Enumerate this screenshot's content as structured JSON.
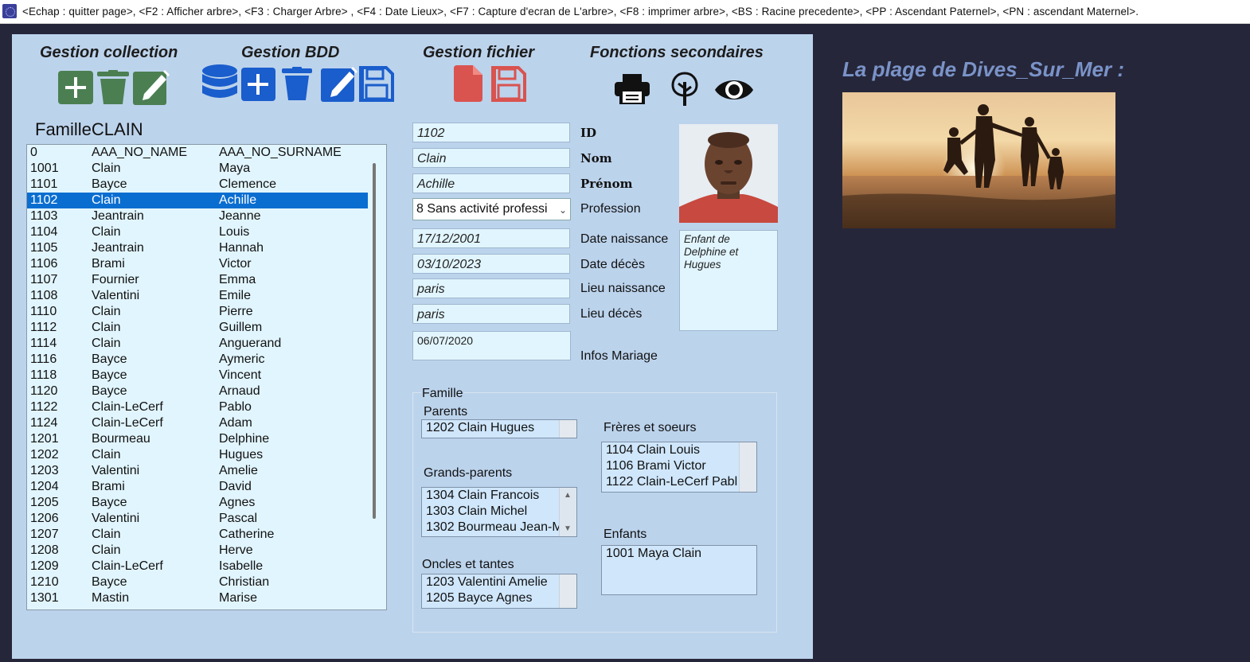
{
  "window": {
    "title": "<Echap : quitter page>, <F2 : Afficher arbre>, <F3 : Charger Arbre> , <F4 : Date Lieux>, <F7 : Capture d'ecran de L'arbre>, <F8 : imprimer arbre>, <BS : Racine precedente>, <PP : Ascendant Paternel>, <PN : ascendant Maternel>."
  },
  "toolbar": {
    "collection": {
      "title": "Gestion collection"
    },
    "bdd": {
      "title": "Gestion BDD"
    },
    "file": {
      "title": "Gestion fichier"
    },
    "secondary": {
      "title": "Fonctions secondaires"
    }
  },
  "colors": {
    "panel": "#bcd3ec",
    "green": "#4b7f52",
    "blue": "#1a5dcc",
    "red": "#d9534f",
    "selection": "#0a6ed1"
  },
  "family": {
    "name": "FamilleCLAIN"
  },
  "persons": [
    [
      "0",
      "AAA_NO_NAME",
      "AAA_NO_SURNAME"
    ],
    [
      "1001",
      "Clain",
      "Maya"
    ],
    [
      "1101",
      "Bayce",
      "Clemence"
    ],
    [
      "1102",
      "Clain",
      "Achille"
    ],
    [
      "1103",
      "Jeantrain",
      "Jeanne"
    ],
    [
      "1104",
      "Clain",
      "Louis"
    ],
    [
      "1105",
      "Jeantrain",
      "Hannah"
    ],
    [
      "1106",
      "Brami",
      "Victor"
    ],
    [
      "1107",
      "Fournier",
      "Emma"
    ],
    [
      "1108",
      "Valentini",
      "Emile"
    ],
    [
      "1110",
      "Clain",
      "Pierre"
    ],
    [
      "1112",
      "Clain",
      "Guillem"
    ],
    [
      "1114",
      "Clain",
      "Anguerand"
    ],
    [
      "1116",
      "Bayce",
      "Aymeric"
    ],
    [
      "1118",
      "Bayce",
      "Vincent"
    ],
    [
      "1120",
      "Bayce",
      "Arnaud"
    ],
    [
      "1122",
      "Clain-LeCerf",
      "Pablo"
    ],
    [
      "1124",
      "Clain-LeCerf",
      "Adam"
    ],
    [
      "1201",
      "Bourmeau",
      "Delphine"
    ],
    [
      "1202",
      "Clain",
      "Hugues"
    ],
    [
      "1203",
      "Valentini",
      "Amelie"
    ],
    [
      "1204",
      "Brami",
      "David"
    ],
    [
      "1205",
      "Bayce",
      "Agnes"
    ],
    [
      "1206",
      "Valentini",
      "Pascal"
    ],
    [
      "1207",
      "Clain",
      "Catherine"
    ],
    [
      "1208",
      "Clain",
      "Herve"
    ],
    [
      "1209",
      "Clain-LeCerf",
      "Isabelle"
    ],
    [
      "1210",
      "Bayce",
      "Christian"
    ],
    [
      "1301",
      "Mastin",
      "Marise"
    ]
  ],
  "selected_index": 3,
  "detail": {
    "id": "1102",
    "nom": "Clain",
    "prenom": "Achille",
    "profession": "8 Sans activité professi",
    "date_naissance": "17/12/2001",
    "date_deces": "03/10/2023",
    "lieu_naissance": "paris",
    "lieu_deces": "paris",
    "mariage": "06/07/2020",
    "info": "Enfant de Delphine et Hugues",
    "labels": {
      "id": "ID",
      "nom": "Nom",
      "prenom": "Prénom",
      "profession": "Profession",
      "date_naissance": "Date naissance",
      "date_deces": "Date décès",
      "lieu_naissance": "Lieu naissance",
      "lieu_deces": "Lieu décès",
      "mariage": "Infos Mariage"
    }
  },
  "relatives": {
    "legend": "Famille",
    "parents_label": "Parents",
    "parents": [
      "1202 Clain Hugues"
    ],
    "grandparents_label": "Grands-parents",
    "grandparents": [
      "1304 Clain Francois",
      "1303 Clain Michel",
      "1302 Bourmeau Jean-M"
    ],
    "uncles_label": "Oncles et tantes",
    "uncles": [
      "1203 Valentini Amelie",
      "1205 Bayce Agnes"
    ],
    "siblings_label": "Frères et soeurs",
    "siblings": [
      "1104 Clain Louis",
      "1106 Brami Victor",
      "1122 Clain-LeCerf Pabl"
    ],
    "children_label": "Enfants",
    "children": [
      "1001 Maya Clain"
    ]
  },
  "scene": {
    "title": "La plage de Dives_Sur_Mer :"
  },
  "icons": [
    "add-icon",
    "trash-icon",
    "edit-icon",
    "database-icon",
    "save-icon",
    "file-icon",
    "print-icon",
    "tree-icon",
    "eye-icon"
  ]
}
